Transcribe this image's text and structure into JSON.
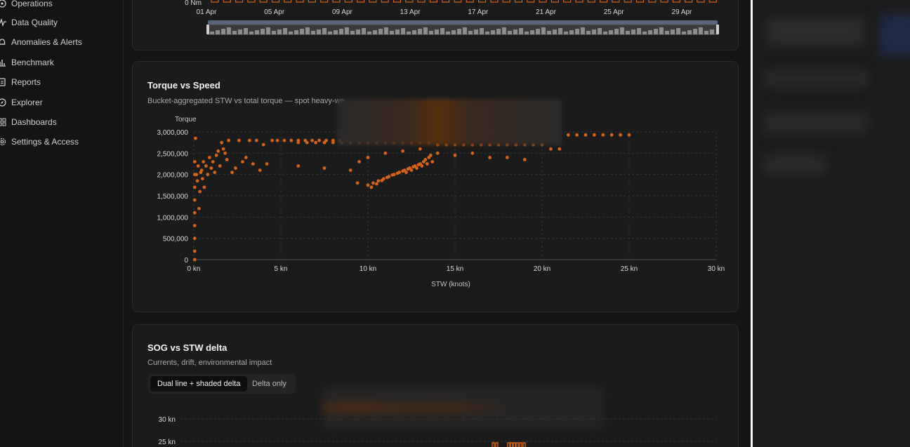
{
  "sidebar": {
    "items": [
      {
        "label": "Operations",
        "icon": "operations-icon"
      },
      {
        "label": "Data Quality",
        "icon": "pulse-icon"
      },
      {
        "label": "Anomalies & Alerts",
        "icon": "bell-icon"
      },
      {
        "label": "Benchmark",
        "icon": "bar-chart-icon"
      },
      {
        "label": "Reports",
        "icon": "document-icon"
      },
      {
        "label": "Explorer",
        "icon": "compass-icon"
      },
      {
        "label": "Dashboards",
        "icon": "grid-icon"
      },
      {
        "label": "Settings & Access",
        "icon": "gear-icon"
      }
    ]
  },
  "timeline_card": {
    "y_min_label": "0 Nm",
    "x_ticks": [
      "01 Apr",
      "05 Apr",
      "09 Apr",
      "13 Apr",
      "17 Apr",
      "21 Apr",
      "25 Apr",
      "29 Apr"
    ]
  },
  "torque_card": {
    "title": "Torque vs Speed",
    "subtitle": "Bucket-aggregated STW vs total torque — spot heavy-we"
  },
  "sog_card": {
    "title": "SOG vs STW delta",
    "subtitle": "Currents, drift, environmental impact",
    "toggle_options": [
      "Dual line + shaded delta",
      "Delta only"
    ],
    "active_option": "Dual line + shaded delta",
    "y_ticks": [
      "30 kn",
      "25 kn"
    ]
  },
  "colors": {
    "accent": "#d4621a",
    "background": "#141414",
    "card": "#1b1b1b"
  },
  "chart_data": {
    "type": "scatter",
    "title": "Torque vs Speed",
    "xlabel": "STW (knots)",
    "ylabel": "Torque",
    "xlim": [
      0,
      30
    ],
    "ylim": [
      0,
      3000000
    ],
    "x_ticks": [
      "0 kn",
      "5 kn",
      "10 kn",
      "15 kn",
      "20 kn",
      "25 kn",
      "30 kn"
    ],
    "y_ticks": [
      "0",
      "500,000",
      "1,000,000",
      "1,500,000",
      "2,000,000",
      "2,500,000",
      "3,000,000"
    ],
    "grid": true,
    "series": [
      {
        "points": [
          [
            0.05,
            0
          ],
          [
            0.05,
            200000
          ],
          [
            0.05,
            500000
          ],
          [
            0.05,
            800000
          ],
          [
            0.05,
            1100000
          ],
          [
            0.05,
            1400000
          ],
          [
            0.05,
            1700000
          ],
          [
            0.05,
            2000000
          ],
          [
            0.05,
            2300000
          ],
          [
            0.1,
            2850000
          ],
          [
            0.15,
            2000000
          ],
          [
            0.2,
            1850000
          ],
          [
            0.25,
            2200000
          ],
          [
            0.3,
            1200000
          ],
          [
            0.35,
            1600000
          ],
          [
            0.4,
            2050000
          ],
          [
            0.45,
            2100000
          ],
          [
            0.5,
            1900000
          ],
          [
            0.55,
            2300000
          ],
          [
            0.6,
            1700000
          ],
          [
            0.7,
            2200000
          ],
          [
            0.8,
            2000000
          ],
          [
            0.9,
            2400000
          ],
          [
            1.0,
            2150000
          ],
          [
            1.1,
            2300000
          ],
          [
            1.2,
            2050000
          ],
          [
            1.3,
            2450000
          ],
          [
            1.4,
            2550000
          ],
          [
            1.5,
            2200000
          ],
          [
            1.6,
            2750000
          ],
          [
            1.7,
            2600000
          ],
          [
            1.8,
            2500000
          ],
          [
            1.9,
            2350000
          ],
          [
            2.0,
            2800000
          ],
          [
            2.2,
            2050000
          ],
          [
            2.4,
            2150000
          ],
          [
            2.6,
            2800000
          ],
          [
            2.8,
            2300000
          ],
          [
            3.0,
            2400000
          ],
          [
            3.2,
            2800000
          ],
          [
            3.4,
            2250000
          ],
          [
            3.6,
            2800000
          ],
          [
            3.8,
            2100000
          ],
          [
            4.0,
            2700000
          ],
          [
            4.2,
            2250000
          ],
          [
            4.5,
            2800000
          ],
          [
            4.8,
            2800000
          ],
          [
            5.2,
            2800000
          ],
          [
            5.6,
            2800000
          ],
          [
            6.0,
            2800000
          ],
          [
            6.4,
            2800000
          ],
          [
            6.8,
            2800000
          ],
          [
            7.2,
            2800000
          ],
          [
            7.6,
            2800000
          ],
          [
            8.0,
            2800000
          ],
          [
            8.4,
            2800000
          ],
          [
            8.8,
            2800000
          ],
          [
            6.0,
            2750000
          ],
          [
            6.5,
            2750000
          ],
          [
            7.0,
            2750000
          ],
          [
            7.5,
            2750000
          ],
          [
            8.0,
            2750000
          ],
          [
            8.5,
            2750000
          ],
          [
            9.0,
            2750000
          ],
          [
            9.5,
            2750000
          ],
          [
            10.0,
            2750000
          ],
          [
            10.5,
            2750000
          ],
          [
            11.0,
            2750000
          ],
          [
            11.5,
            2750000
          ],
          [
            12.0,
            2750000
          ],
          [
            12.5,
            2750000
          ],
          [
            13.0,
            2750000
          ],
          [
            13.5,
            2750000
          ],
          [
            14.0,
            2700000
          ],
          [
            14.5,
            2700000
          ],
          [
            15.0,
            2700000
          ],
          [
            15.5,
            2700000
          ],
          [
            16.0,
            2700000
          ],
          [
            16.5,
            2700000
          ],
          [
            17.0,
            2700000
          ],
          [
            17.5,
            2700000
          ],
          [
            18.0,
            2700000
          ],
          [
            18.5,
            2700000
          ],
          [
            19.0,
            2700000
          ],
          [
            19.5,
            2700000
          ],
          [
            20.0,
            2700000
          ],
          [
            20.5,
            2600000
          ],
          [
            21.0,
            2600000
          ],
          [
            6.0,
            2200000
          ],
          [
            7.5,
            2150000
          ],
          [
            9.0,
            2100000
          ],
          [
            9.5,
            2300000
          ],
          [
            10.0,
            2400000
          ],
          [
            11.0,
            2500000
          ],
          [
            12.0,
            2550000
          ],
          [
            13.0,
            2600000
          ],
          [
            14.0,
            2500000
          ],
          [
            15.0,
            2450000
          ],
          [
            16.0,
            2500000
          ],
          [
            17.0,
            2400000
          ],
          [
            18.0,
            2400000
          ],
          [
            19.0,
            2350000
          ],
          [
            10.0,
            1750000
          ],
          [
            10.3,
            1800000
          ],
          [
            10.6,
            1850000
          ],
          [
            10.9,
            1900000
          ],
          [
            11.2,
            1950000
          ],
          [
            11.5,
            2000000
          ],
          [
            11.8,
            2050000
          ],
          [
            12.1,
            2100000
          ],
          [
            12.4,
            2150000
          ],
          [
            12.7,
            2200000
          ],
          [
            13.0,
            2250000
          ],
          [
            13.3,
            2350000
          ],
          [
            13.6,
            2450000
          ],
          [
            10.2,
            1700000
          ],
          [
            10.5,
            1780000
          ],
          [
            10.8,
            1860000
          ],
          [
            11.1,
            1930000
          ],
          [
            11.4,
            1990000
          ],
          [
            11.7,
            2030000
          ],
          [
            12.0,
            2080000
          ],
          [
            12.3,
            2130000
          ],
          [
            12.6,
            2180000
          ],
          [
            12.9,
            2230000
          ],
          [
            13.2,
            2300000
          ],
          [
            13.5,
            2400000
          ],
          [
            12.2,
            2050000
          ],
          [
            12.5,
            2100000
          ],
          [
            12.8,
            2150000
          ],
          [
            13.1,
            2200000
          ],
          [
            13.4,
            2250000
          ],
          [
            13.7,
            2300000
          ],
          [
            9.4,
            1800000
          ],
          [
            21.5,
            2930000
          ],
          [
            22.0,
            2930000
          ],
          [
            22.5,
            2930000
          ],
          [
            23.0,
            2930000
          ],
          [
            23.5,
            2930000
          ],
          [
            24.0,
            2930000
          ],
          [
            24.5,
            2930000
          ],
          [
            25.0,
            2930000
          ]
        ]
      }
    ]
  }
}
